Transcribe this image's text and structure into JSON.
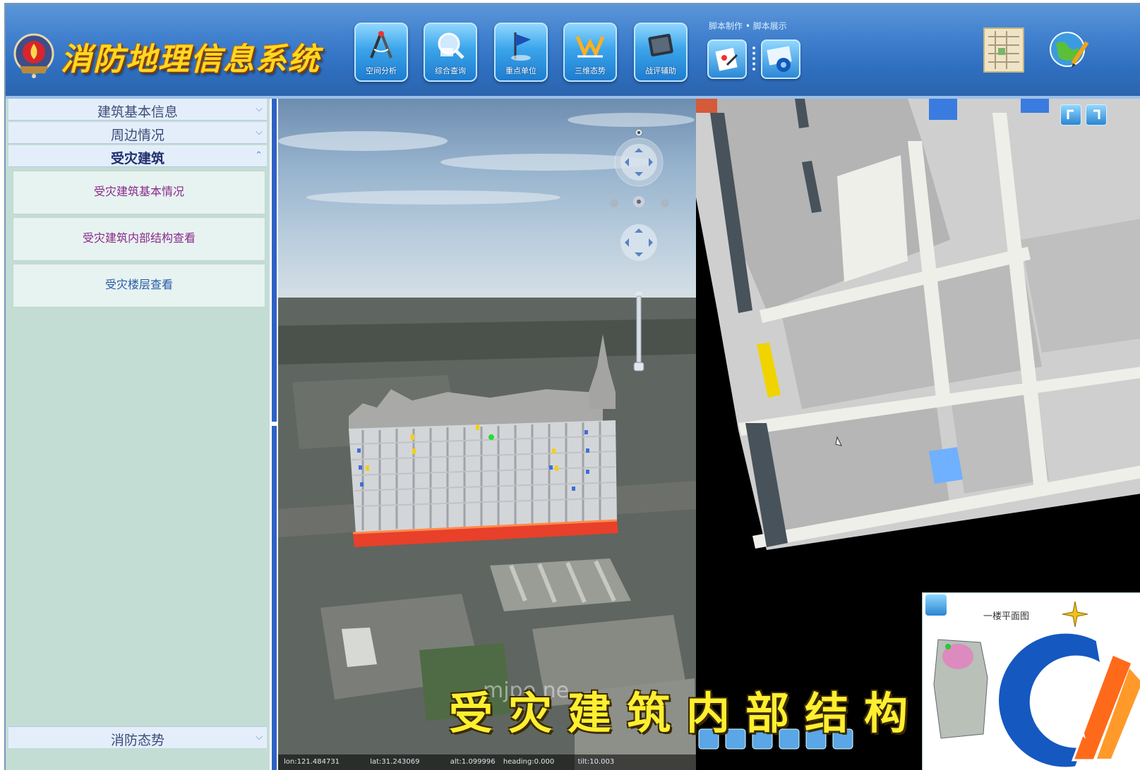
{
  "header": {
    "title": "消防地理信息系统",
    "tools": [
      {
        "label": "空间分析",
        "icon": "compass-icon"
      },
      {
        "label": "综合查询",
        "icon": "globe-search-icon"
      },
      {
        "label": "重点单位",
        "icon": "flag-icon"
      },
      {
        "label": "三维态势",
        "icon": "3d-terrain-icon"
      },
      {
        "label": "战评辅助",
        "icon": "tablet-icon"
      }
    ],
    "script_nav": {
      "make": "脚本制作",
      "show": "脚本展示"
    },
    "right_icons": [
      "map-thumbnail-icon",
      "globe-pencil-icon"
    ]
  },
  "sidebar": {
    "sections": [
      {
        "label": "建筑基本信息",
        "state": "collapsed"
      },
      {
        "label": "周边情况",
        "state": "collapsed"
      },
      {
        "label": "受灾建筑",
        "state": "expanded"
      }
    ],
    "items": [
      {
        "label": "受灾建筑基本情况",
        "color": "#8a2a8a"
      },
      {
        "label": "受灾建筑内部结构查看",
        "color": "#8a2a8a"
      },
      {
        "label": "受灾楼层查看",
        "color": "#2a5aa8"
      }
    ],
    "bottom_section": {
      "label": "消防态势",
      "state": "collapsed"
    }
  },
  "map3d": {
    "status": {
      "lon": "lon:121.484731",
      "lat": "lat:31.243069",
      "alt": "alt:1.099996",
      "heading": "heading:0.000",
      "tilt": "tilt:10.003"
    },
    "watermark": "mjpe ne"
  },
  "floorplan": {
    "minimap_title": "一楼平面图"
  },
  "caption": "受灾建筑内部结构",
  "colors": {
    "header_blue": "#3f7fcd",
    "title_gold": "#ffd820",
    "sidebar_bg": "#c3ddd5",
    "splitter_blue": "#2e61c4",
    "fire_red": "#e8402a"
  }
}
